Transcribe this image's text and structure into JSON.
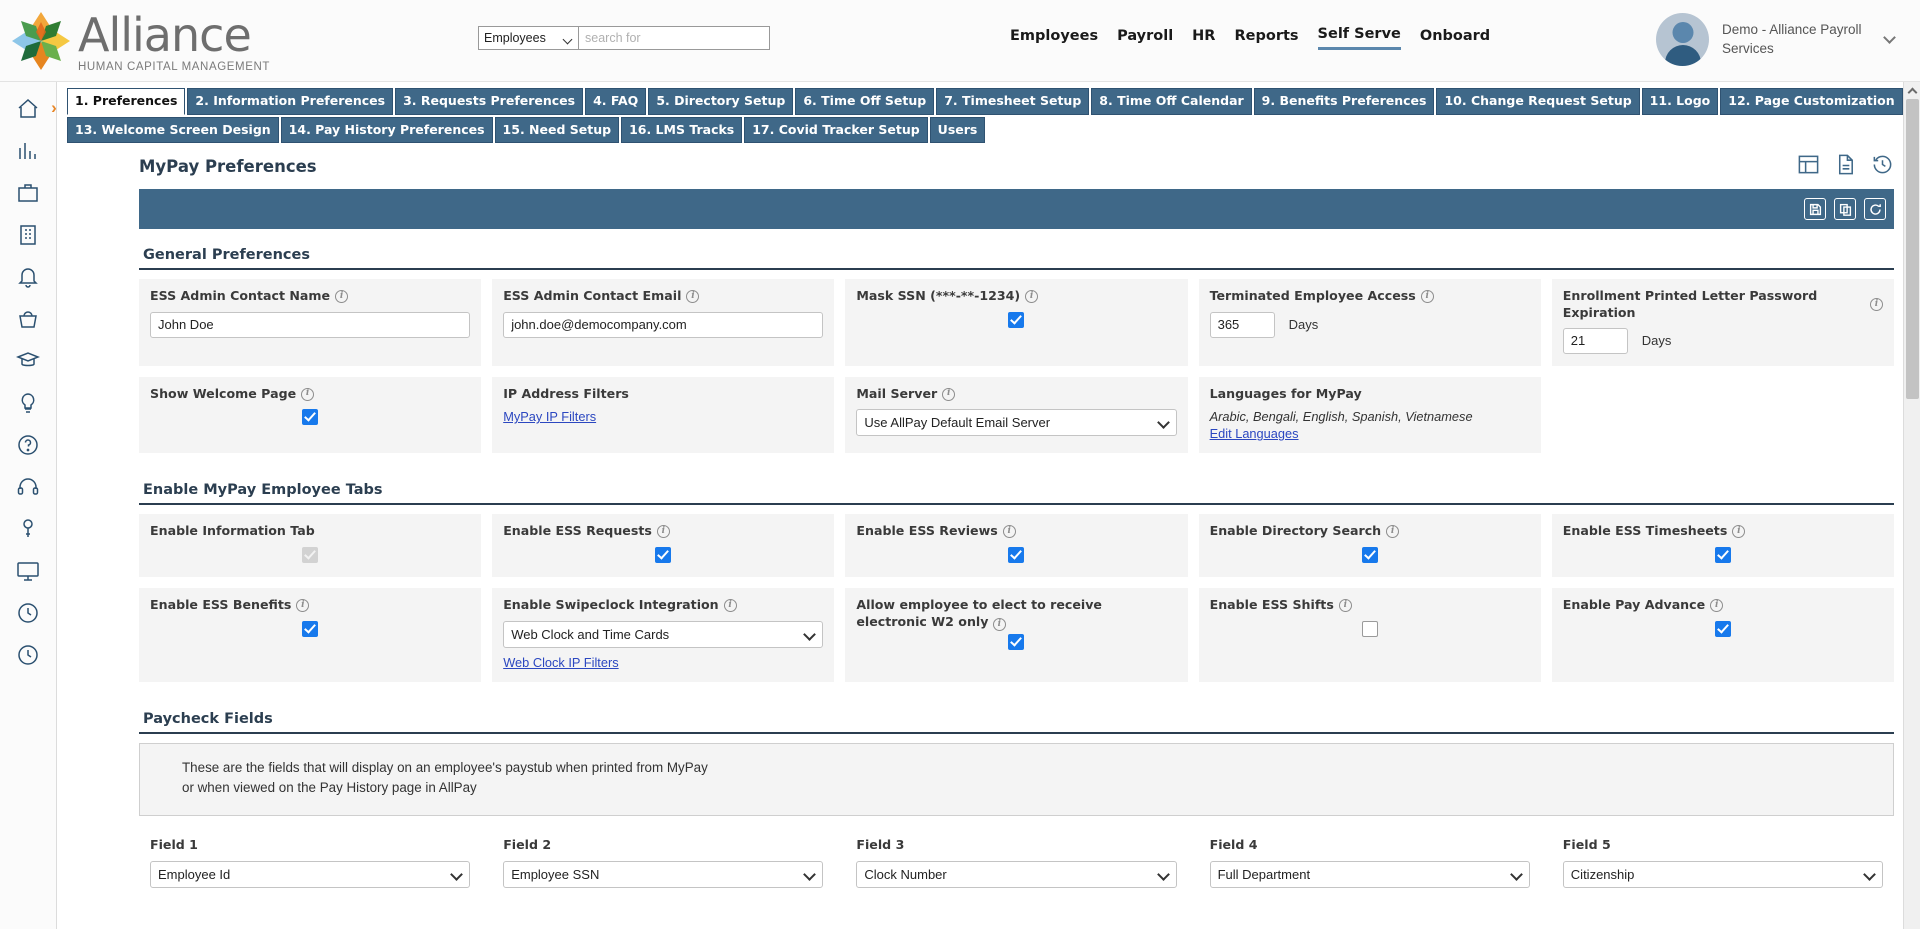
{
  "header": {
    "brand_name": "Alliance",
    "brand_sub": "HUMAN CAPITAL MANAGEMENT",
    "search": {
      "scope_value": "Employees",
      "placeholder": "search for",
      "value": ""
    },
    "nav": [
      {
        "label": "Employees",
        "active": false
      },
      {
        "label": "Payroll",
        "active": false
      },
      {
        "label": "HR",
        "active": false
      },
      {
        "label": "Reports",
        "active": false
      },
      {
        "label": "Self Serve",
        "active": true
      },
      {
        "label": "Onboard",
        "active": false
      }
    ],
    "profile": {
      "name": "Demo - Alliance Payroll Services"
    }
  },
  "sidebar": {
    "items": [
      {
        "name": "home-icon"
      },
      {
        "name": "chart-bars-icon"
      },
      {
        "name": "briefcase-icon"
      },
      {
        "name": "building-icon"
      },
      {
        "name": "bell-icon"
      },
      {
        "name": "basket-icon"
      },
      {
        "name": "graduation-cap-icon"
      },
      {
        "name": "lightbulb-icon"
      },
      {
        "name": "question-circle-icon"
      },
      {
        "name": "headset-icon"
      },
      {
        "name": "key-icon"
      },
      {
        "name": "monitor-icon"
      },
      {
        "name": "clock-icon"
      },
      {
        "name": "clock-history-icon"
      }
    ]
  },
  "tabs": {
    "row1": [
      {
        "label": "1. Preferences",
        "active": true
      },
      {
        "label": "2. Information Preferences",
        "active": false
      },
      {
        "label": "3. Requests Preferences",
        "active": false
      },
      {
        "label": "4. FAQ",
        "active": false
      },
      {
        "label": "5. Directory Setup",
        "active": false
      },
      {
        "label": "6. Time Off Setup",
        "active": false
      },
      {
        "label": "7. Timesheet Setup",
        "active": false
      },
      {
        "label": "8. Time Off Calendar",
        "active": false
      },
      {
        "label": "9. Benefits Preferences",
        "active": false
      },
      {
        "label": "10. Change Request Setup",
        "active": false
      },
      {
        "label": "11. Logo",
        "active": false
      },
      {
        "label": "12. Page Customization",
        "active": false
      },
      {
        "label": "12. Page Customization",
        "active": false
      }
    ],
    "row2": [
      {
        "label": "13. Welcome Screen Design",
        "active": false
      },
      {
        "label": "14. Pay History Preferences",
        "active": false
      },
      {
        "label": "15. Need Setup",
        "active": false
      },
      {
        "label": "16. LMS Tracks",
        "active": false
      },
      {
        "label": "17. Covid Tracker Setup",
        "active": false
      },
      {
        "label": "Users",
        "active": false
      }
    ]
  },
  "page": {
    "title": "MyPay Preferences",
    "head_icons": [
      "grid-icon",
      "document-icon",
      "history-icon"
    ],
    "toolbar_icons": [
      "save-icon",
      "copy-icon",
      "refresh-icon"
    ]
  },
  "general_preferences": {
    "title": "General Preferences",
    "fields": {
      "admin_name": {
        "label": "ESS Admin Contact Name",
        "value": "John Doe",
        "info": true
      },
      "admin_email": {
        "label": "ESS Admin Contact Email",
        "value": "john.doe@democompany.com",
        "info": true
      },
      "mask_ssn": {
        "label": "Mask SSN (***-**-1234)",
        "checked": true,
        "info": true
      },
      "terminated_access": {
        "label": "Terminated Employee Access",
        "value": "365",
        "unit": "Days",
        "info": true
      },
      "letter_expiration": {
        "label": "Enrollment Printed Letter Password Expiration",
        "value": "21",
        "unit": "Days",
        "info": true
      },
      "show_welcome": {
        "label": "Show Welcome Page",
        "checked": true,
        "info": true
      },
      "ip_filters": {
        "label": "IP Address Filters",
        "link": "MyPay IP Filters",
        "info": false
      },
      "mail_server": {
        "label": "Mail Server",
        "value": "Use AllPay Default Email Server",
        "info": true
      },
      "languages": {
        "label": "Languages for MyPay",
        "value": "Arabic, Bengali, English, Spanish, Vietnamese",
        "link": "Edit Languages"
      }
    }
  },
  "employee_tabs": {
    "title": "Enable MyPay Employee Tabs",
    "fields": {
      "information_tab": {
        "label": "Enable Information Tab",
        "checked": true,
        "disabled": true,
        "info": false
      },
      "ess_requests": {
        "label": "Enable ESS Requests",
        "checked": true,
        "info": true
      },
      "ess_reviews": {
        "label": "Enable ESS Reviews",
        "checked": true,
        "info": true
      },
      "directory_search": {
        "label": "Enable Directory Search",
        "checked": true,
        "info": true
      },
      "ess_timesheets": {
        "label": "Enable ESS Timesheets",
        "checked": true,
        "info": true
      },
      "ess_benefits": {
        "label": "Enable ESS Benefits",
        "checked": true,
        "info": true
      },
      "swipeclock": {
        "label": "Enable Swipeclock Integration",
        "value": "Web Clock and Time Cards",
        "link": "Web Clock IP Filters",
        "info": true
      },
      "electronic_w2": {
        "label": "Allow employee to elect to receive electronic W2 only",
        "checked": true,
        "info": true
      },
      "ess_shifts": {
        "label": "Enable ESS Shifts",
        "checked": false,
        "info": true
      },
      "pay_advance": {
        "label": "Enable Pay Advance",
        "checked": true,
        "info": true
      }
    }
  },
  "paycheck_fields": {
    "title": "Paycheck Fields",
    "note_line1": "These are the fields that will display on an employee's paystub when printed from MyPay",
    "note_line2": "or when viewed on the Pay History page in AllPay",
    "fields": [
      {
        "label": "Field 1",
        "value": "Employee Id"
      },
      {
        "label": "Field 2",
        "value": "Employee SSN"
      },
      {
        "label": "Field 3",
        "value": "Clock Number"
      },
      {
        "label": "Field 4",
        "value": "Full Department"
      },
      {
        "label": "Field 5",
        "value": "Citizenship"
      }
    ]
  },
  "colors": {
    "brand_blue": "#3f6888",
    "accent_orange": "#e8882a",
    "checkbox_blue": "#1779ec",
    "dark_navy": "#2b3e50"
  }
}
